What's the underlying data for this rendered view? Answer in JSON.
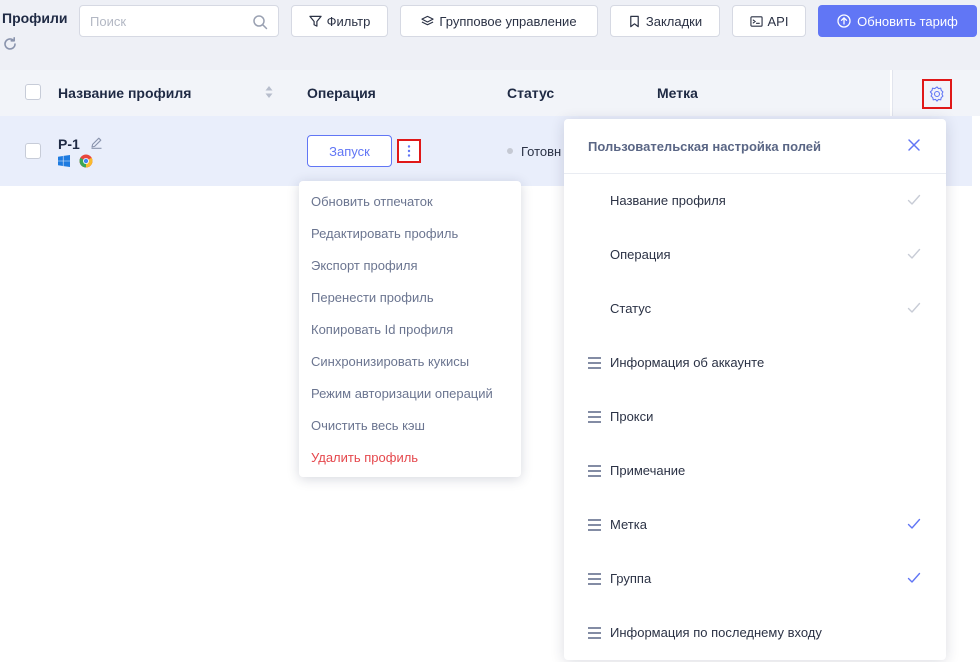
{
  "toolbar": {
    "title": "Профили",
    "search_placeholder": "Поиск",
    "filter_label": "Фильтр",
    "group_label": "Групповое управление",
    "bookmarks_label": "Закладки",
    "api_label": "API",
    "upgrade_label": "Обновить тариф"
  },
  "table": {
    "columns": [
      "Название профиля",
      "Операция",
      "Статус",
      "Метка"
    ],
    "rows": [
      {
        "name": "P-1",
        "os_icons": [
          "windows-icon",
          "chrome-icon"
        ],
        "operation": "Запуск",
        "status": "Готовн"
      }
    ]
  },
  "context_menu": {
    "items": [
      "Обновить отпечаток",
      "Редактировать профиль",
      "Экспорт профиля",
      "Перенести профиль",
      "Копировать Id профиля",
      "Синхронизировать кукисы",
      "Режим авторизации операций",
      "Очистить весь кэш",
      "Удалить профиль"
    ],
    "danger_item": "Удалить профиль"
  },
  "field_panel": {
    "title": "Пользовательская настройка полей",
    "fields": [
      {
        "label": "Название профиля",
        "draggable": false,
        "checked": true,
        "locked": true
      },
      {
        "label": "Операция",
        "draggable": false,
        "checked": true,
        "locked": true
      },
      {
        "label": "Статус",
        "draggable": false,
        "checked": true,
        "locked": true
      },
      {
        "label": "Информация об аккаунте",
        "draggable": true,
        "checked": false,
        "locked": false
      },
      {
        "label": "Прокси",
        "draggable": true,
        "checked": false,
        "locked": false
      },
      {
        "label": "Примечание",
        "draggable": true,
        "checked": false,
        "locked": false
      },
      {
        "label": "Метка",
        "draggable": true,
        "checked": true,
        "locked": false
      },
      {
        "label": "Группа",
        "draggable": true,
        "checked": true,
        "locked": false
      },
      {
        "label": "Информация по последнему входу",
        "draggable": true,
        "checked": false,
        "locked": false
      }
    ]
  },
  "colors": {
    "accent": "#6176f5",
    "highlight_border": "#e01818",
    "danger": "#e5484d",
    "row_selected": "#e9eefb",
    "locked_check": "#c8ccd6"
  }
}
